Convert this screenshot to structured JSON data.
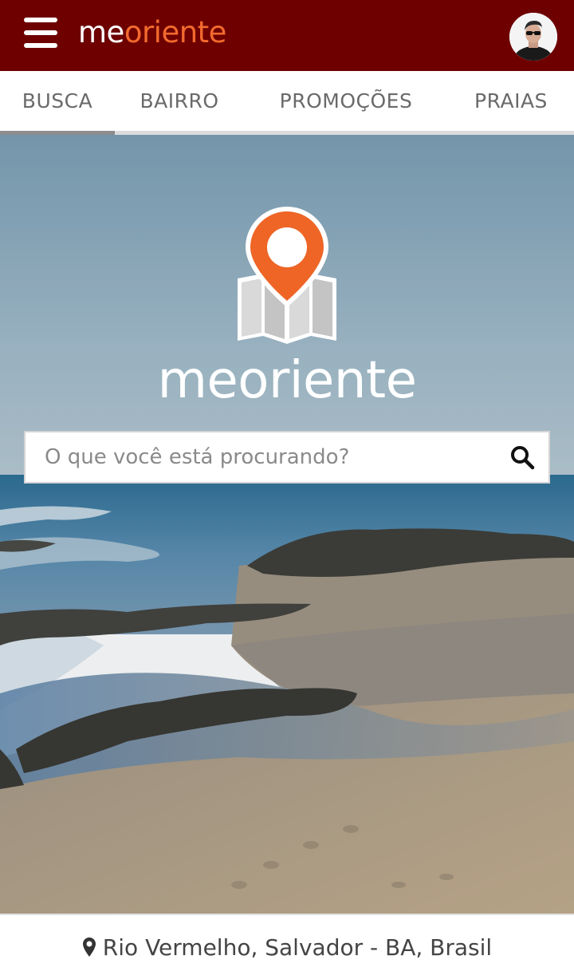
{
  "header": {
    "brand_me": "me",
    "brand_oriente": "oriente",
    "menu_icon": "hamburger-menu-icon",
    "avatar_icon": "user-avatar"
  },
  "tabs": [
    {
      "label": "BUSCA",
      "active": true
    },
    {
      "label": "BAIRRO",
      "active": false
    },
    {
      "label": "PROMOÇÕES",
      "active": false
    },
    {
      "label": "PRAIAS",
      "active": false
    }
  ],
  "hero": {
    "logo_text": "meoriente",
    "search": {
      "placeholder": "O que você está procurando?",
      "value": ""
    }
  },
  "location": {
    "text": "Rio Vermelho, Salvador - BA, Brasil",
    "icon": "map-pin-icon"
  },
  "colors": {
    "header_bg": "#6e0000",
    "accent": "#f26a2e",
    "text_gray": "#6a6a6a"
  }
}
